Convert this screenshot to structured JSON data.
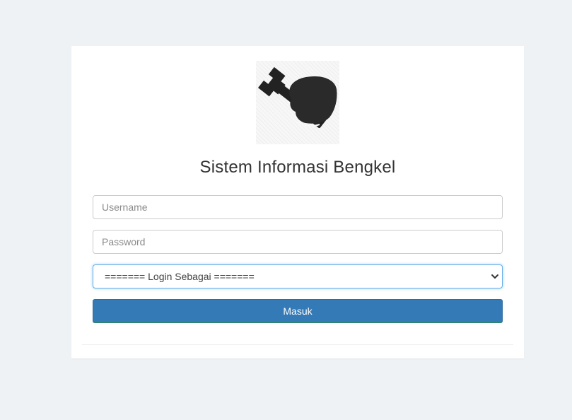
{
  "app": {
    "title": "Sistem Informasi Bengkel",
    "logo_icon": "wrench-hand-icon"
  },
  "form": {
    "username_placeholder": "Username",
    "password_placeholder": "Password",
    "role_select": {
      "selected": "======= Login Sebagai ======="
    },
    "submit_label": "Masuk"
  },
  "colors": {
    "page_background": "#eff2f5",
    "card_background": "#ffffff",
    "primary_button": "#337ab7",
    "focus_border": "#66afe9",
    "title_text": "#333333"
  }
}
